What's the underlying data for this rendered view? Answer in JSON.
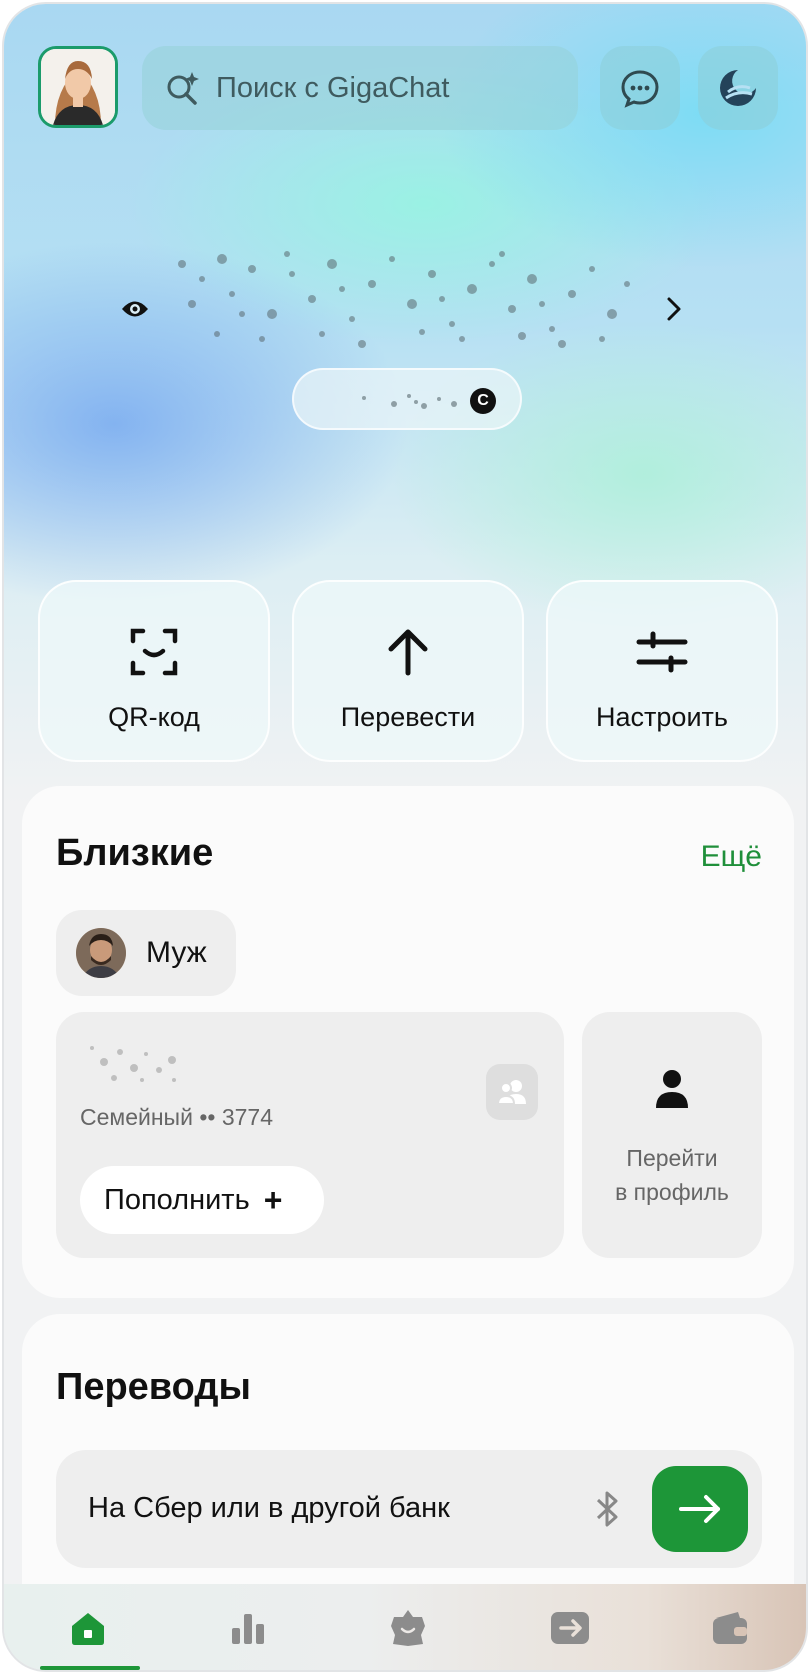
{
  "header": {
    "search_placeholder": "Поиск с GigaChat"
  },
  "balance": {
    "card_badge": "C"
  },
  "quick_actions": [
    {
      "label": "QR-код",
      "icon": "qr-scan-icon"
    },
    {
      "label": "Перевести",
      "icon": "arrow-up-icon"
    },
    {
      "label": "Настроить",
      "icon": "sliders-icon"
    }
  ],
  "close_ones": {
    "title": "Близкие",
    "more": "Ещё",
    "contact_name": "Муж",
    "account_subtitle": "Семейный •• 3774",
    "topup_label": "Пополнить",
    "topup_icon": "+",
    "profile_label_line1": "Перейти",
    "profile_label_line2": "в профиль"
  },
  "transfers": {
    "title": "Переводы",
    "row_label": "На Сбер или в другой банк"
  },
  "tabbar": {
    "items": [
      {
        "icon": "home-icon",
        "active": true
      },
      {
        "icon": "bar-chart-icon",
        "active": false
      },
      {
        "icon": "star-face-icon",
        "active": false
      },
      {
        "icon": "transfer-icon",
        "active": false
      },
      {
        "icon": "wallet-icon",
        "active": false
      }
    ]
  },
  "colors": {
    "accent_green": "#1d9638",
    "avatar_border": "#1b9b6b"
  }
}
